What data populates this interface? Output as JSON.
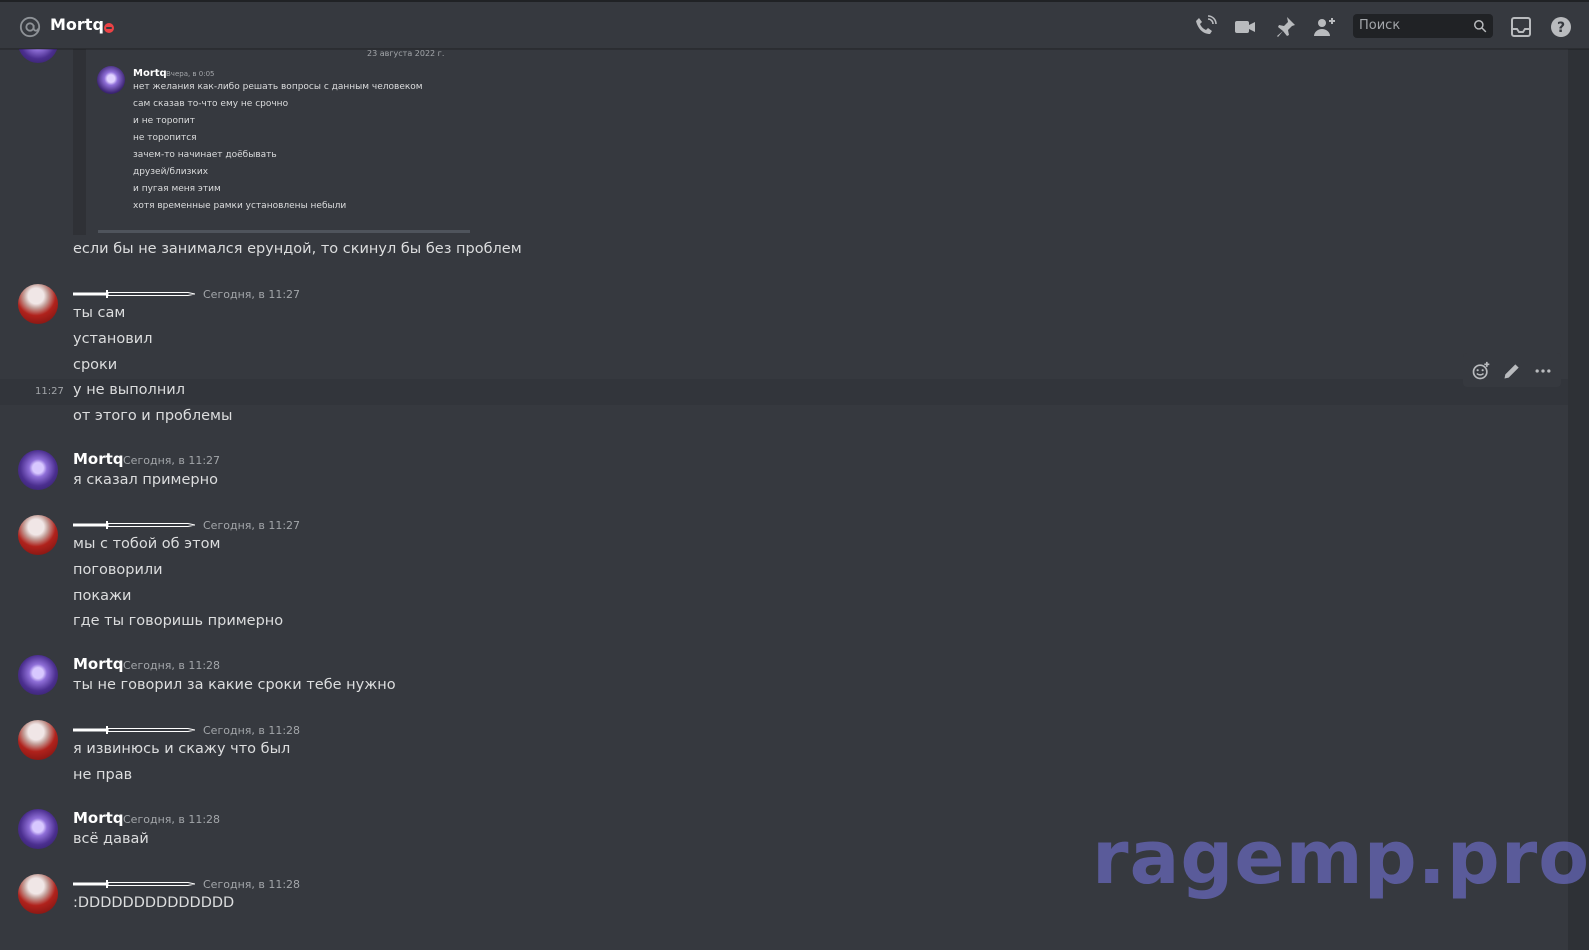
{
  "header": {
    "channel_name": "Mortq",
    "search_placeholder": "Поиск",
    "icons": [
      "at-icon",
      "phone-call-icon",
      "video-camera-icon",
      "pin-icon",
      "add-friend-icon",
      "search-icon",
      "inbox-icon",
      "help-icon"
    ]
  },
  "embed": {
    "date": "23 августа 2022 г.",
    "author": "Mortq",
    "timestamp": "Вчера, в 0:05",
    "lines": [
      "нет желания как-либо решать вопросы с данным человеком",
      "сам сказав то-что ему не срочно",
      "и не торопит",
      "не торопится",
      "зачем-то начинает доёбывать",
      "друзей/близких",
      "и пугая меня этим",
      "хотя временные рамки установлены небыли"
    ]
  },
  "messages": {
    "m0": {
      "lines": [
        "если бы не занимался ерундой, то скинул бы без проблем"
      ]
    },
    "m1": {
      "timestamp": "Сегодня, в 11:27",
      "lines": [
        "ты сам",
        "установил",
        "сроки",
        "у не выполнил",
        "от этого и проблемы"
      ],
      "hover_time": "11:27"
    },
    "m2": {
      "author": "Mortq",
      "timestamp": "Сегодня, в 11:27",
      "lines": [
        "я сказал примерно"
      ]
    },
    "m3": {
      "timestamp": "Сегодня, в 11:27",
      "lines": [
        "мы с тобой об этом",
        "поговорили",
        "покажи",
        "где ты говоришь примерно"
      ]
    },
    "m4": {
      "author": "Mortq",
      "timestamp": "Сегодня, в 11:28",
      "lines": [
        "ты не говорил за какие сроки тебе нужно"
      ]
    },
    "m5": {
      "timestamp": "Сегодня, в 11:28",
      "lines": [
        "я извинюсь и скажу что был",
        "не прав"
      ]
    },
    "m6": {
      "author": "Mortq",
      "timestamp": "Сегодня, в 11:28",
      "lines": [
        "всё давай"
      ]
    },
    "m7": {
      "timestamp": "Сегодня, в 11:28",
      "lines": [
        ":DDDDDDDDDDDDDD"
      ]
    }
  },
  "hover_toolbar": {
    "icons": [
      "add-reaction-icon",
      "edit-icon",
      "more-icon"
    ]
  },
  "watermark": "ragemp.pro",
  "colors": {
    "background": "#36393f",
    "text": "#dcddde",
    "muted": "#a3a6aa",
    "dnd": "#ed4245",
    "watermark": "#7878e6"
  }
}
